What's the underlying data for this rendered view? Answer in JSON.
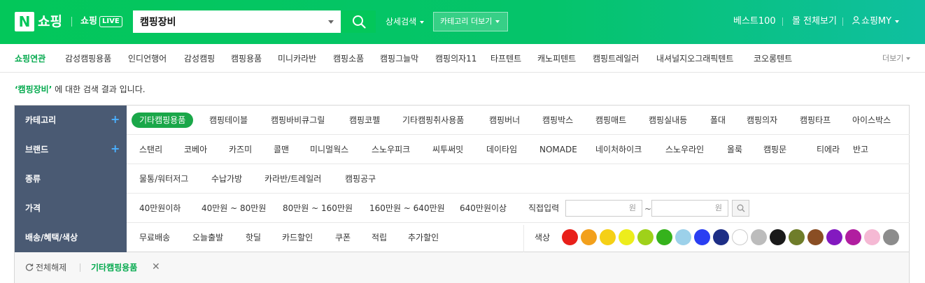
{
  "header": {
    "logo_n": "N",
    "logo_text": "쇼핑",
    "live_text": "쇼핑",
    "live_badge": "LIVE",
    "search_value": "캠핑장비",
    "detail_search": "상세검색",
    "category_more": "카테고리 더보기",
    "best100": "베스트100",
    "mall_all": "몰 전체보기",
    "my_shopping": "쇼핑MY"
  },
  "related": {
    "title": "쇼핑연관",
    "items": [
      "감성캠핑용품",
      "인디언행어",
      "감성캠핑",
      "캠핑용품",
      "미니카라반",
      "캠핑소품",
      "캠핑그늘막",
      "캠핑의자11",
      "타프텐트",
      "캐노피텐트",
      "캠핑트레일러",
      "내셔널지오그래픽텐트",
      "코오롱텐트"
    ],
    "more": "더보기"
  },
  "result_message": {
    "keyword": "‘캠핑장비’",
    "suffix": " 에 대한 검색 결과 입니다."
  },
  "filters": {
    "category": {
      "label": "카테고리",
      "items": [
        "기타캠핑용품",
        "캠핑테이블",
        "캠핑바비큐그릴",
        "캠핑코펠",
        "기타캠핑취사용품",
        "캠핑버너",
        "캠핑박스",
        "캠핑매트",
        "캠핑실내등",
        "폴대",
        "캠핑의자",
        "캠핑타프",
        "아이스박스"
      ],
      "selected": "기타캠핑용품"
    },
    "brand": {
      "label": "브랜드",
      "items": [
        "스탠리",
        "코베아",
        "카즈미",
        "콜맨",
        "미니멀웍스",
        "스노우피크",
        "씨투써밋",
        "데이타임",
        "NOMADE",
        "네이처하이크",
        "스노우라인",
        "올룩",
        "캠핑문",
        "티에라",
        "반고"
      ]
    },
    "type": {
      "label": "종류",
      "items": [
        "물통/워터저그",
        "수납가방",
        "카라반/트레일러",
        "캠핑공구"
      ]
    },
    "price": {
      "label": "가격",
      "items": [
        "40만원이하",
        "40만원 ~ 80만원",
        "80만원 ~ 160만원",
        "160만원 ~ 640만원",
        "640만원이상"
      ],
      "direct_input": "직접입력",
      "unit": "원",
      "range_sep": "~"
    },
    "delivery": {
      "label": "배송/혜택/색상",
      "items": [
        "무료배송",
        "오늘출발",
        "핫딜",
        "카드할인",
        "쿠폰",
        "적립",
        "추가할인"
      ],
      "color_label": "색상",
      "colors": [
        "#e8201a",
        "#f2a01c",
        "#f5d016",
        "#eded1c",
        "#9fd11a",
        "#35b21c",
        "#9cd1ea",
        "#2a3ef2",
        "#1d2e86",
        "#ffffff",
        "#bcbcbc",
        "#1a1a1a",
        "#6f7d2a",
        "#8a4e24",
        "#8319c0",
        "#b11ea0",
        "#f5b9d4",
        "#8c8c8c"
      ]
    }
  },
  "selected_bar": {
    "reset": "전체해제",
    "tag": "기타캠핑용품"
  }
}
